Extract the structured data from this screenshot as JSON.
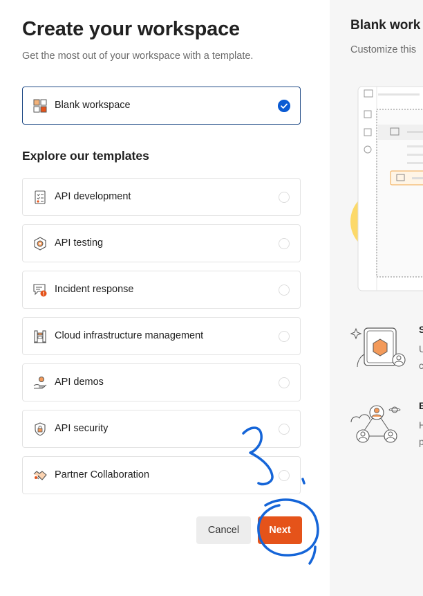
{
  "header": {
    "title": "Create your workspace",
    "subtitle": "Get the most out of your workspace with a template."
  },
  "blank": {
    "label": "Blank workspace",
    "selected": true,
    "icon": "grid-icon"
  },
  "templates": {
    "heading": "Explore our templates",
    "items": [
      {
        "label": "API development",
        "icon": "checklist-icon"
      },
      {
        "label": "API testing",
        "icon": "gear-hexagon-icon"
      },
      {
        "label": "Incident response",
        "icon": "chat-alert-icon"
      },
      {
        "label": "Cloud infrastructure management",
        "icon": "server-icon"
      },
      {
        "label": "API demos",
        "icon": "hand-presenting-icon"
      },
      {
        "label": "API security",
        "icon": "shield-lock-icon"
      },
      {
        "label": "Partner Collaboration",
        "icon": "handshake-icon"
      }
    ]
  },
  "actions": {
    "cancel": "Cancel",
    "next": "Next"
  },
  "preview": {
    "title": "Blank work",
    "subtitle": "Customize this",
    "feature1": {
      "heading": "S",
      "line1": "U",
      "line2": "c"
    },
    "feature2": {
      "heading": "E",
      "line1": "H",
      "line2": "p"
    }
  },
  "colors": {
    "accent": "#e5531a",
    "selected_border": "#1f4a86",
    "check": "#0b5bd3",
    "annotation": "#1565d8"
  }
}
